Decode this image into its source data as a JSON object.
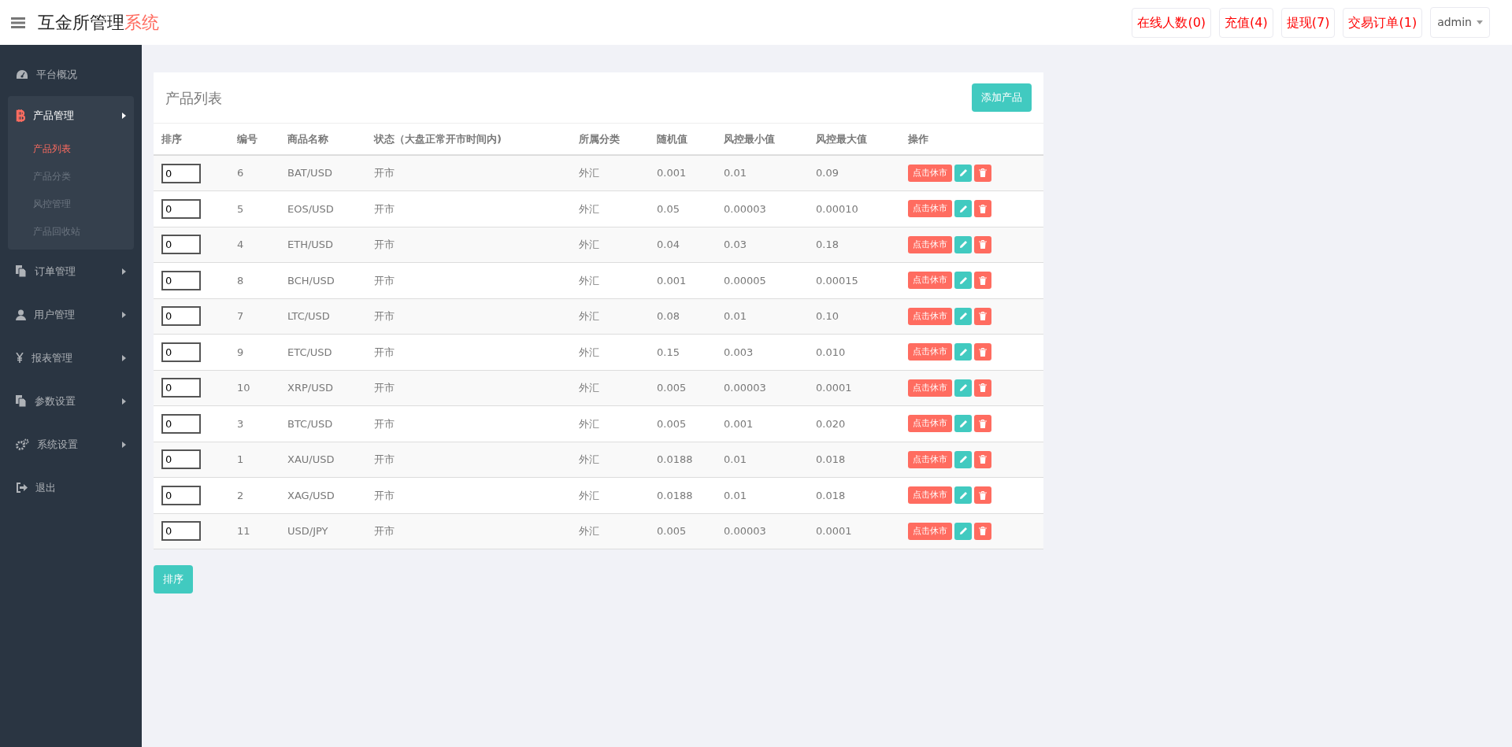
{
  "header": {
    "title": "互金所管理",
    "title_accent": "系统",
    "buttons": [
      "在线人数(0)",
      "充值(4)",
      "提现(7)",
      "交易订单(1)"
    ],
    "user": "admin"
  },
  "sidebar": {
    "items": [
      {
        "label": "平台概况",
        "expanded": false,
        "has_arrow": false
      },
      {
        "label": "产品管理",
        "expanded": true,
        "has_arrow": true,
        "children": [
          {
            "label": "产品列表",
            "selected": true
          },
          {
            "label": "产品分类",
            "selected": false
          },
          {
            "label": "风控管理",
            "selected": false
          },
          {
            "label": "产品回收站",
            "selected": false
          }
        ]
      },
      {
        "label": "订单管理",
        "expanded": false,
        "has_arrow": true
      },
      {
        "label": "用户管理",
        "expanded": false,
        "has_arrow": true
      },
      {
        "label": "报表管理",
        "expanded": false,
        "has_arrow": true
      },
      {
        "label": "参数设置",
        "expanded": false,
        "has_arrow": true
      },
      {
        "label": "系统设置",
        "expanded": false,
        "has_arrow": true
      },
      {
        "label": "退出",
        "expanded": false,
        "has_arrow": false
      }
    ]
  },
  "panel": {
    "title": "产品列表",
    "add_button": "添加产品",
    "columns": [
      "排序",
      "编号",
      "商品名称",
      "状态（大盘正常开市时间内)",
      "所属分类",
      "随机值",
      "风控最小值",
      "风控最大值",
      "操作"
    ],
    "rows": [
      {
        "sort": "0",
        "id": "6",
        "name": "BAT/USD",
        "status": "开市",
        "category": "外汇",
        "random": "0.001",
        "min": "0.01",
        "max": "0.09",
        "action": "点击休市"
      },
      {
        "sort": "0",
        "id": "5",
        "name": "EOS/USD",
        "status": "开市",
        "category": "外汇",
        "random": "0.05",
        "min": "0.00003",
        "max": "0.00010",
        "action": "点击休市"
      },
      {
        "sort": "0",
        "id": "4",
        "name": "ETH/USD",
        "status": "开市",
        "category": "外汇",
        "random": "0.04",
        "min": "0.03",
        "max": "0.18",
        "action": "点击休市"
      },
      {
        "sort": "0",
        "id": "8",
        "name": "BCH/USD",
        "status": "开市",
        "category": "外汇",
        "random": "0.001",
        "min": "0.00005",
        "max": "0.00015",
        "action": "点击休市"
      },
      {
        "sort": "0",
        "id": "7",
        "name": "LTC/USD",
        "status": "开市",
        "category": "外汇",
        "random": "0.08",
        "min": "0.01",
        "max": "0.10",
        "action": "点击休市"
      },
      {
        "sort": "0",
        "id": "9",
        "name": "ETC/USD",
        "status": "开市",
        "category": "外汇",
        "random": "0.15",
        "min": "0.003",
        "max": "0.010",
        "action": "点击休市"
      },
      {
        "sort": "0",
        "id": "10",
        "name": "XRP/USD",
        "status": "开市",
        "category": "外汇",
        "random": "0.005",
        "min": "0.00003",
        "max": "0.0001",
        "action": "点击休市"
      },
      {
        "sort": "0",
        "id": "3",
        "name": "BTC/USD",
        "status": "开市",
        "category": "外汇",
        "random": "0.005",
        "min": "0.001",
        "max": "0.020",
        "action": "点击休市"
      },
      {
        "sort": "0",
        "id": "1",
        "name": "XAU/USD",
        "status": "开市",
        "category": "外汇",
        "random": "0.0188",
        "min": "0.01",
        "max": "0.018",
        "action": "点击休市"
      },
      {
        "sort": "0",
        "id": "2",
        "name": "XAG/USD",
        "status": "开市",
        "category": "外汇",
        "random": "0.0188",
        "min": "0.01",
        "max": "0.018",
        "action": "点击休市"
      },
      {
        "sort": "0",
        "id": "11",
        "name": "USD/JPY",
        "status": "开市",
        "category": "外汇",
        "random": "0.005",
        "min": "0.00003",
        "max": "0.0001",
        "action": "点击休市"
      }
    ]
  },
  "sort_button": "排序"
}
